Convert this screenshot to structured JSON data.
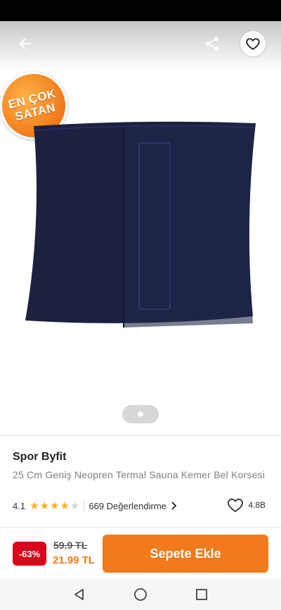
{
  "header": {
    "back_icon": "arrow-left-icon",
    "share_icon": "share-icon",
    "favorite_icon": "heart-outline-icon"
  },
  "badge": {
    "line1": "EN ÇOK",
    "line2": "SATAN",
    "color": "#f27a1a"
  },
  "gallery": {
    "page_count": 1,
    "active_index": 0
  },
  "product": {
    "brand": "Spor Byfit",
    "title": "25 Cm Geniş Neopren Termal Sauna Kemer Bel Korsesi",
    "rating": "4.1",
    "rating_stars": 4.1,
    "reviews_label": "669 Değerlendirme",
    "favorites_count": "4.8B",
    "product_color": "#1c2140"
  },
  "cart": {
    "discount": "-63%",
    "old_price": "59.9 TL",
    "new_price": "21.99 TL",
    "add_button_label": "Sepete Ekle",
    "accent": "#f27a1a",
    "discount_color": "#d9071b"
  },
  "system_nav": {
    "back": "triangle-back-icon",
    "home": "circle-home-icon",
    "recents": "square-recents-icon"
  }
}
